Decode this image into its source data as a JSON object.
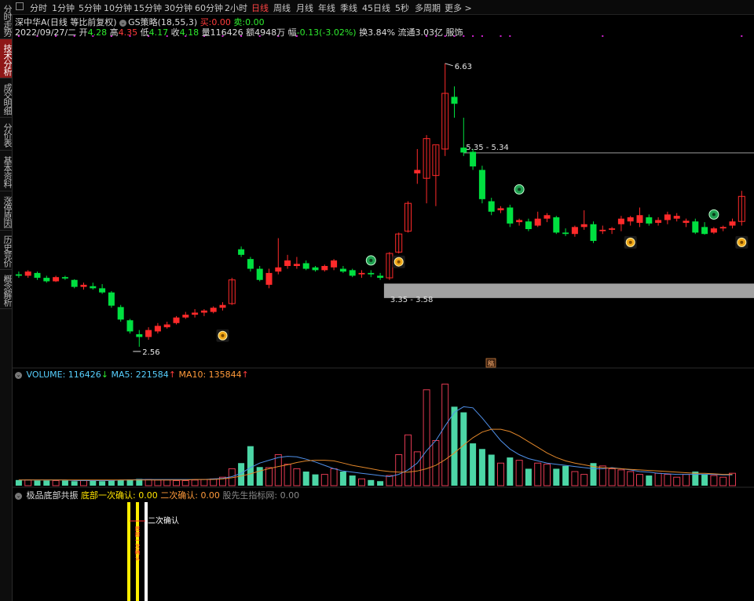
{
  "sidebar": {
    "tabs": [
      {
        "label": "分时走势",
        "active": false
      },
      {
        "label": "技术分析",
        "active": true
      },
      {
        "label": "成交明细",
        "active": false
      },
      {
        "label": "分价表",
        "active": false
      },
      {
        "label": "基本资料",
        "active": false
      },
      {
        "label": "涨停原因",
        "active": false
      },
      {
        "label": "历史竞价",
        "active": false
      },
      {
        "label": "概念解析",
        "active": false
      }
    ]
  },
  "toolbar": {
    "periods": [
      "分时",
      "1分钟",
      "5分钟",
      "10分钟",
      "15分钟",
      "30分钟",
      "60分钟",
      "2小时",
      "日线",
      "周线",
      "月线",
      "年线",
      "季线",
      "45日线",
      "5秒",
      "多周期",
      "更多 >"
    ],
    "active_period": "日线"
  },
  "header": {
    "stock_name": "深中华A(日线 等比前复权)",
    "indicator_name": "GS策略(18,55,3)",
    "buy_label": "买:",
    "buy_value": "0.00",
    "sell_label": "卖:",
    "sell_value": "0.00",
    "date": "2022/09/27/二",
    "open_label": "开",
    "open_value": "4.28",
    "high_label": "高",
    "high_value": "4.35",
    "low_label": "低",
    "low_value": "4.17",
    "close_label": "收",
    "close_value": "4.18",
    "volume_label": "量",
    "volume_value": "116426",
    "amount_label": "额",
    "amount_value": "4948万",
    "change_label": "幅",
    "change_value": "-0.13(-3.02%)",
    "turnover_label": "换",
    "turnover_value": "3.84%",
    "float_label": "流通",
    "float_value": "3.03亿",
    "sector": "服饰"
  },
  "annotations": {
    "high_price": "6.63",
    "low_price": "2.56",
    "resistance_range": "5.35 - 5.34",
    "support_range": "3.35 - 3.58",
    "event_marker": "稿"
  },
  "volume_panel": {
    "title": "VOLUME:",
    "volume_value": "116426",
    "volume_arrow": "↓",
    "ma5_label": "MA5:",
    "ma5_value": "221584",
    "ma5_arrow": "↑",
    "ma10_label": "MA10:",
    "ma10_value": "135844",
    "ma10_arrow": "↑"
  },
  "indicator_panel": {
    "title": "极品底部共振",
    "first_label": "底部一次确认:",
    "first_value": "0.00",
    "second_label": "二次确认:",
    "second_value": "0.00",
    "source_label": "股先生指标网:",
    "source_value": "0.00",
    "signal_label": "二次确认",
    "signal_vertical_text": "底部一次确认"
  },
  "colors": {
    "up": "#ff2a2a",
    "down": "#00e040",
    "vol_up_outline": "#e23a52",
    "vol_down": "#4cd6a6",
    "ma5": "#4f8fe8",
    "ma10": "#e0862a",
    "support_box": "#bdbdbd",
    "signal_yellow": "#ffee00",
    "signal_white": "#ffffff",
    "accent_red": "#8e1717"
  },
  "chart_data": {
    "type": "candlestick",
    "ylim": [
      2.3,
      7.0
    ],
    "candles": [
      {
        "o": 3.6,
        "h": 3.64,
        "l": 3.55,
        "c": 3.58
      },
      {
        "o": 3.58,
        "h": 3.66,
        "l": 3.55,
        "c": 3.64
      },
      {
        "o": 3.62,
        "h": 3.64,
        "l": 3.52,
        "c": 3.55
      },
      {
        "o": 3.55,
        "h": 3.58,
        "l": 3.48,
        "c": 3.5
      },
      {
        "o": 3.5,
        "h": 3.58,
        "l": 3.49,
        "c": 3.56
      },
      {
        "o": 3.56,
        "h": 3.58,
        "l": 3.52,
        "c": 3.54
      },
      {
        "o": 3.52,
        "h": 3.53,
        "l": 3.4,
        "c": 3.42
      },
      {
        "o": 3.42,
        "h": 3.48,
        "l": 3.38,
        "c": 3.45
      },
      {
        "o": 3.43,
        "h": 3.48,
        "l": 3.38,
        "c": 3.4
      },
      {
        "o": 3.4,
        "h": 3.46,
        "l": 3.32,
        "c": 3.34
      },
      {
        "o": 3.34,
        "h": 3.36,
        "l": 3.12,
        "c": 3.15
      },
      {
        "o": 3.13,
        "h": 3.16,
        "l": 2.92,
        "c": 2.95
      },
      {
        "o": 2.94,
        "h": 2.96,
        "l": 2.75,
        "c": 2.78
      },
      {
        "o": 2.74,
        "h": 2.8,
        "l": 2.56,
        "c": 2.7
      },
      {
        "o": 2.7,
        "h": 2.84,
        "l": 2.66,
        "c": 2.8
      },
      {
        "o": 2.78,
        "h": 2.9,
        "l": 2.75,
        "c": 2.86
      },
      {
        "o": 2.84,
        "h": 2.92,
        "l": 2.82,
        "c": 2.88
      },
      {
        "o": 2.9,
        "h": 3.0,
        "l": 2.88,
        "c": 2.98
      },
      {
        "o": 2.98,
        "h": 3.06,
        "l": 2.96,
        "c": 3.02
      },
      {
        "o": 3.02,
        "h": 3.1,
        "l": 2.98,
        "c": 3.05
      },
      {
        "o": 3.05,
        "h": 3.1,
        "l": 3.0,
        "c": 3.08
      },
      {
        "o": 3.06,
        "h": 3.14,
        "l": 3.04,
        "c": 3.12
      },
      {
        "o": 3.12,
        "h": 3.2,
        "l": 3.08,
        "c": 3.16
      },
      {
        "o": 3.18,
        "h": 3.55,
        "l": 3.16,
        "c": 3.52
      },
      {
        "o": 3.96,
        "h": 4.0,
        "l": 3.85,
        "c": 3.88
      },
      {
        "o": 3.82,
        "h": 3.85,
        "l": 3.64,
        "c": 3.68
      },
      {
        "o": 3.68,
        "h": 3.72,
        "l": 3.5,
        "c": 3.52
      },
      {
        "o": 3.45,
        "h": 3.68,
        "l": 3.4,
        "c": 3.62
      },
      {
        "o": 3.64,
        "h": 4.12,
        "l": 3.6,
        "c": 3.7
      },
      {
        "o": 3.72,
        "h": 3.88,
        "l": 3.68,
        "c": 3.8
      },
      {
        "o": 3.72,
        "h": 3.85,
        "l": 3.68,
        "c": 3.75
      },
      {
        "o": 3.76,
        "h": 3.8,
        "l": 3.66,
        "c": 3.68
      },
      {
        "o": 3.7,
        "h": 3.72,
        "l": 3.64,
        "c": 3.66
      },
      {
        "o": 3.66,
        "h": 3.74,
        "l": 3.64,
        "c": 3.72
      },
      {
        "o": 3.7,
        "h": 3.82,
        "l": 3.66,
        "c": 3.8
      },
      {
        "o": 3.68,
        "h": 3.72,
        "l": 3.62,
        "c": 3.64
      },
      {
        "o": 3.66,
        "h": 3.68,
        "l": 3.56,
        "c": 3.58
      },
      {
        "o": 3.6,
        "h": 3.66,
        "l": 3.55,
        "c": 3.62
      },
      {
        "o": 3.62,
        "h": 3.66,
        "l": 3.56,
        "c": 3.6
      },
      {
        "o": 3.58,
        "h": 3.62,
        "l": 3.52,
        "c": 3.55
      },
      {
        "o": 3.55,
        "h": 3.92,
        "l": 3.52,
        "c": 3.9
      },
      {
        "o": 3.92,
        "h": 4.2,
        "l": 3.9,
        "c": 4.18
      },
      {
        "o": 4.22,
        "h": 4.65,
        "l": 4.2,
        "c": 4.62
      },
      {
        "o": 5.05,
        "h": 5.4,
        "l": 4.9,
        "c": 5.1
      },
      {
        "o": 4.98,
        "h": 5.6,
        "l": 4.62,
        "c": 5.55
      },
      {
        "o": 5.02,
        "h": 5.45,
        "l": 4.58,
        "c": 5.46
      },
      {
        "o": 5.4,
        "h": 6.63,
        "l": 5.3,
        "c": 6.2
      },
      {
        "o": 6.15,
        "h": 6.3,
        "l": 5.85,
        "c": 6.05
      },
      {
        "o": 5.42,
        "h": 5.85,
        "l": 5.3,
        "c": 5.35
      },
      {
        "o": 5.36,
        "h": 5.4,
        "l": 5.1,
        "c": 5.15
      },
      {
        "o": 5.1,
        "h": 5.16,
        "l": 4.62,
        "c": 4.68
      },
      {
        "o": 4.65,
        "h": 4.7,
        "l": 4.45,
        "c": 4.5
      },
      {
        "o": 4.52,
        "h": 4.58,
        "l": 4.48,
        "c": 4.55
      },
      {
        "o": 4.56,
        "h": 4.6,
        "l": 4.28,
        "c": 4.33
      },
      {
        "o": 4.35,
        "h": 4.4,
        "l": 4.3,
        "c": 4.38
      },
      {
        "o": 4.36,
        "h": 4.4,
        "l": 4.22,
        "c": 4.25
      },
      {
        "o": 4.3,
        "h": 4.5,
        "l": 4.28,
        "c": 4.4
      },
      {
        "o": 4.4,
        "h": 4.48,
        "l": 4.35,
        "c": 4.45
      },
      {
        "o": 4.42,
        "h": 4.44,
        "l": 4.18,
        "c": 4.2
      },
      {
        "o": 4.2,
        "h": 4.26,
        "l": 4.15,
        "c": 4.18
      },
      {
        "o": 4.18,
        "h": 4.3,
        "l": 4.14,
        "c": 4.28
      },
      {
        "o": 4.28,
        "h": 4.52,
        "l": 4.24,
        "c": 4.32
      },
      {
        "o": 4.32,
        "h": 4.36,
        "l": 4.05,
        "c": 4.08
      },
      {
        "o": 4.22,
        "h": 4.3,
        "l": 4.18,
        "c": 4.24
      },
      {
        "o": 4.24,
        "h": 4.28,
        "l": 4.18,
        "c": 4.26
      },
      {
        "o": 4.32,
        "h": 4.44,
        "l": 4.22,
        "c": 4.4
      },
      {
        "o": 4.36,
        "h": 4.44,
        "l": 4.3,
        "c": 4.42
      },
      {
        "o": 4.34,
        "h": 4.56,
        "l": 4.28,
        "c": 4.45
      },
      {
        "o": 4.42,
        "h": 4.46,
        "l": 4.3,
        "c": 4.33
      },
      {
        "o": 4.34,
        "h": 4.42,
        "l": 4.3,
        "c": 4.38
      },
      {
        "o": 4.38,
        "h": 4.5,
        "l": 4.32,
        "c": 4.46
      },
      {
        "o": 4.4,
        "h": 4.48,
        "l": 4.36,
        "c": 4.44
      },
      {
        "o": 4.34,
        "h": 4.4,
        "l": 4.28,
        "c": 4.37
      },
      {
        "o": 4.36,
        "h": 4.4,
        "l": 4.18,
        "c": 4.2
      },
      {
        "o": 4.28,
        "h": 4.35,
        "l": 4.17,
        "c": 4.18
      },
      {
        "o": 4.2,
        "h": 4.28,
        "l": 4.18,
        "c": 4.26
      },
      {
        "o": 4.26,
        "h": 4.3,
        "l": 4.22,
        "c": 4.28
      },
      {
        "o": 4.3,
        "h": 4.4,
        "l": 4.26,
        "c": 4.36
      },
      {
        "o": 4.36,
        "h": 4.8,
        "l": 4.3,
        "c": 4.72
      }
    ],
    "volume": [
      10,
      10,
      9,
      9,
      9,
      9,
      8,
      9,
      9,
      8,
      9,
      10,
      11,
      12,
      11,
      10,
      10,
      9,
      9,
      10,
      11,
      12,
      15,
      30,
      40,
      70,
      33,
      32,
      55,
      38,
      30,
      25,
      20,
      20,
      30,
      25,
      18,
      12,
      10,
      8,
      18,
      55,
      90,
      60,
      170,
      80,
      180,
      140,
      130,
      75,
      65,
      55,
      40,
      50,
      45,
      30,
      40,
      38,
      30,
      35,
      25,
      20,
      40,
      35,
      30,
      28,
      25,
      20,
      18,
      22,
      20,
      15,
      20,
      25,
      20,
      18,
      15,
      22
    ],
    "ma5": [
      10,
      10,
      10,
      10,
      10,
      10,
      9,
      9,
      9,
      9,
      9,
      10,
      10,
      11,
      11,
      11,
      11,
      11,
      11,
      11,
      11,
      12,
      13,
      16,
      22,
      32,
      40,
      45,
      50,
      52,
      51,
      47,
      42,
      36,
      30,
      26,
      24,
      22,
      20,
      18,
      16,
      20,
      28,
      40,
      62,
      80,
      106,
      130,
      140,
      138,
      120,
      100,
      80,
      65,
      55,
      48,
      44,
      40,
      38,
      36,
      34,
      32,
      30,
      30,
      32,
      30,
      28,
      25,
      24,
      22,
      21,
      20,
      20,
      20,
      20,
      20,
      19,
      19
    ],
    "ma10": [
      10,
      10,
      10,
      10,
      10,
      10,
      10,
      10,
      10,
      10,
      10,
      10,
      10,
      10,
      10,
      10,
      10,
      10,
      10,
      11,
      11,
      11,
      12,
      14,
      17,
      21,
      26,
      30,
      34,
      37,
      41,
      44,
      45,
      45,
      44,
      40,
      36,
      33,
      30,
      27,
      25,
      24,
      24,
      26,
      30,
      36,
      46,
      58,
      72,
      85,
      95,
      100,
      100,
      96,
      88,
      78,
      68,
      58,
      50,
      44,
      40,
      37,
      34,
      32,
      31,
      30,
      29,
      28,
      27,
      26,
      25,
      24,
      23,
      22,
      22,
      21,
      20,
      20
    ],
    "markers": [
      {
        "index": 22,
        "type": "gold",
        "level": 2.72
      },
      {
        "index": 38,
        "type": "green",
        "level": 3.8
      },
      {
        "index": 41,
        "type": "gold",
        "level": 3.78
      },
      {
        "index": 54,
        "type": "green",
        "level": 4.82
      },
      {
        "index": 66,
        "type": "gold",
        "level": 4.06
      },
      {
        "index": 75,
        "type": "green",
        "level": 4.46
      },
      {
        "index": 78,
        "type": "gold",
        "level": 4.06
      }
    ]
  }
}
